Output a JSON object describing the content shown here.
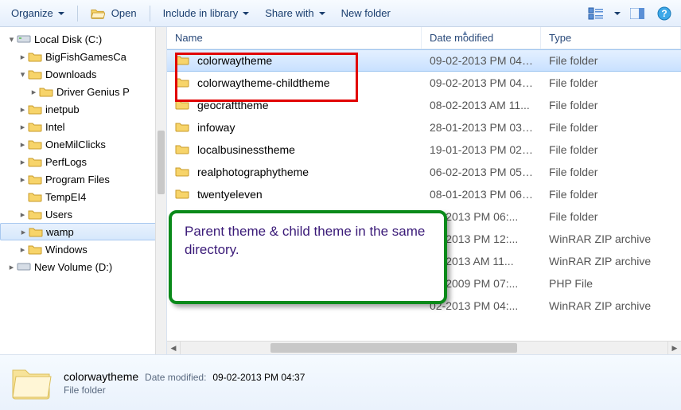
{
  "toolbar": {
    "organize": "Organize",
    "open": "Open",
    "include": "Include in library",
    "share": "Share with",
    "newfolder": "New folder"
  },
  "columns": {
    "name": "Name",
    "date": "Date modified",
    "type": "Type"
  },
  "tree": {
    "root": {
      "label": "Local Disk (C:)",
      "expand": "▾"
    },
    "bigfish": {
      "label": "BigFishGamesCa",
      "expand": "▸"
    },
    "downloads": {
      "label": "Downloads",
      "expand": "▾"
    },
    "driver": {
      "label": "Driver Genius P",
      "expand": "▸"
    },
    "inetpub": {
      "label": "inetpub",
      "expand": "▸"
    },
    "intel": {
      "label": "Intel",
      "expand": "▸"
    },
    "onemil": {
      "label": "OneMilClicks",
      "expand": "▸"
    },
    "perflogs": {
      "label": "PerfLogs",
      "expand": "▸"
    },
    "progfiles": {
      "label": "Program Files",
      "expand": "▸"
    },
    "tempei": {
      "label": "TempEI4",
      "expand": ""
    },
    "users": {
      "label": "Users",
      "expand": "▸"
    },
    "wamp": {
      "label": "wamp",
      "expand": "▸"
    },
    "windows": {
      "label": "Windows",
      "expand": "▸"
    },
    "newvol": {
      "label": "New Volume (D:)",
      "expand": "▸"
    }
  },
  "rows": [
    {
      "name": "colorwaytheme",
      "date": "09-02-2013 PM 04:...",
      "type": "File folder",
      "icon": "folder",
      "selected": true
    },
    {
      "name": "colorwaytheme-childtheme",
      "date": "09-02-2013 PM 04:...",
      "type": "File folder",
      "icon": "folder"
    },
    {
      "name": "geocrafttheme",
      "date": "08-02-2013 AM 11...",
      "type": "File folder",
      "icon": "folder"
    },
    {
      "name": "infoway",
      "date": "28-01-2013 PM 03:...",
      "type": "File folder",
      "icon": "folder"
    },
    {
      "name": "localbusinesstheme",
      "date": "19-01-2013 PM 02:...",
      "type": "File folder",
      "icon": "folder"
    },
    {
      "name": "realphotographytheme",
      "date": "06-02-2013 PM 05:...",
      "type": "File folder",
      "icon": "folder"
    },
    {
      "name": "twentyeleven",
      "date": "08-01-2013 PM 06:...",
      "type": "File folder",
      "icon": "folder"
    },
    {
      "name": "",
      "date": "01-2013 PM 06:...",
      "type": "File folder",
      "icon": "hidden"
    },
    {
      "name": "",
      "date": "01-2013 PM 12:...",
      "type": "WinRAR ZIP archive",
      "icon": "hidden"
    },
    {
      "name": "",
      "date": "02-2013 AM 11...",
      "type": "WinRAR ZIP archive",
      "icon": "hidden"
    },
    {
      "name": "",
      "date": "04-2009 PM 07:...",
      "type": "PHP File",
      "icon": "hidden"
    },
    {
      "name": "",
      "date": "02-2013 PM 04:...",
      "type": "WinRAR ZIP archive",
      "icon": "hidden"
    }
  ],
  "details": {
    "name": "colorwaytheme",
    "modlabel": "Date modified:",
    "modval": "09-02-2013 PM 04:37",
    "type": "File folder"
  },
  "annotation": {
    "text": "Parent theme & child theme in the same directory."
  }
}
